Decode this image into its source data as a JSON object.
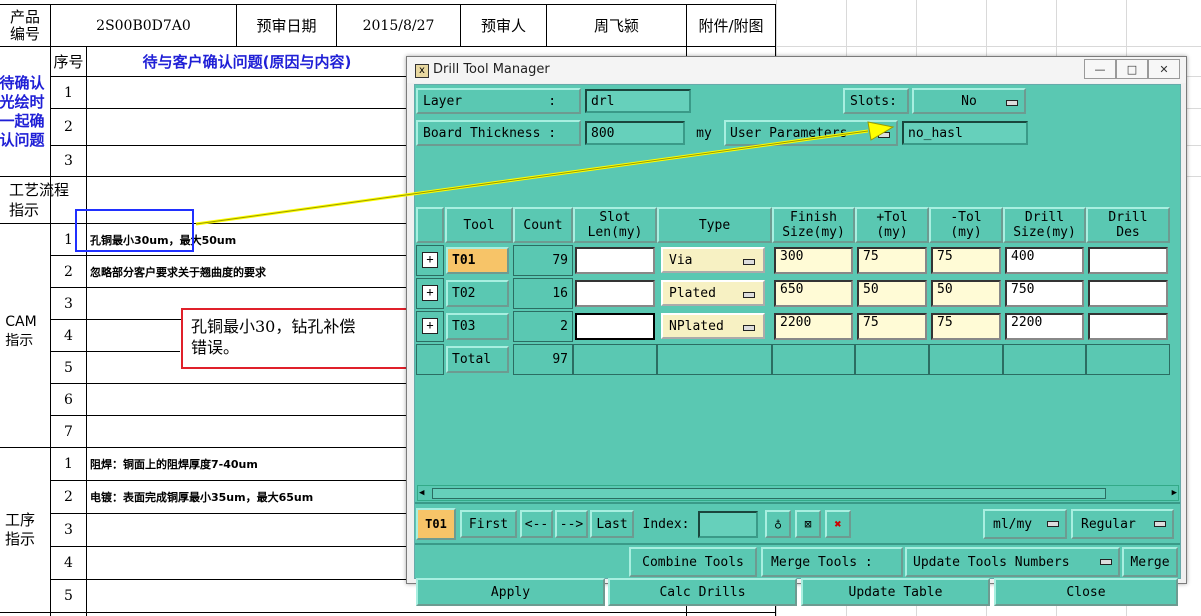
{
  "sheet": {
    "header": {
      "product_label": "产品\n编号",
      "product_code": "2S00B0D7A0",
      "review_date_label": "预审日期",
      "review_date": "2015/8/27",
      "reviewer_label": "预审人",
      "reviewer": "周飞颍",
      "attachment_label": "附件/附图"
    },
    "seq_label": "序号",
    "pending_label": "待与客户确认问题(原因与内容)",
    "pending_side": "待确认\n光绘时\n一起确\n认问题",
    "process_side": "工艺流程\n指示",
    "cam_side": "CAM\n指示",
    "procedure_side": "工序\n指示",
    "pending_rows": [
      "1",
      "2",
      "3"
    ],
    "cam_rows": [
      {
        "no": "1",
        "text": "孔铜最小30um，最大50um"
      },
      {
        "no": "2",
        "text": "忽略部分客户要求关于翘曲度的要求"
      },
      {
        "no": "3",
        "text": ""
      },
      {
        "no": "4",
        "text": ""
      },
      {
        "no": "5",
        "text": ""
      },
      {
        "no": "6",
        "text": ""
      },
      {
        "no": "7",
        "text": ""
      }
    ],
    "procedure_rows": [
      {
        "no": "1",
        "text": "阻焊：铜面上的阻焊厚度7-40um"
      },
      {
        "no": "2",
        "text": "电镀：表面完成铜厚最小35um，最大65um"
      },
      {
        "no": "3",
        "text": ""
      },
      {
        "no": "4",
        "text": ""
      },
      {
        "no": "5",
        "text": ""
      }
    ],
    "callout": "孔铜最小30，钻孔补偿\n错误。"
  },
  "dialog": {
    "title": "Drill Tool Manager",
    "layer_label": "Layer           :",
    "layer_value": "drl",
    "slots_label": "Slots:",
    "slots_value": "No",
    "board_thickness_label": "Board Thickness :",
    "board_thickness_value": "800",
    "board_thickness_unit": "my",
    "user_params_label": "User Parameters",
    "user_params_value": "no_hasl",
    "columns": [
      "Tool",
      "Count",
      "Slot\nLen(my)",
      "Type",
      "Finish\nSize(my)",
      "+Tol\n(my)",
      "-Tol\n(my)",
      "Drill\nSize(my)",
      "Drill\nDes"
    ],
    "rows": [
      {
        "tool": "T01",
        "count": "79",
        "slot": "",
        "type": "Via",
        "finish": "300",
        "ptol": "75",
        "ntol": "75",
        "drill": "400",
        "des": ""
      },
      {
        "tool": "T02",
        "count": "16",
        "slot": "",
        "type": "Plated",
        "finish": "650",
        "ptol": "50",
        "ntol": "50",
        "drill": "750",
        "des": ""
      },
      {
        "tool": "T03",
        "count": "2",
        "slot": "",
        "type": "NPlated",
        "finish": "2200",
        "ptol": "75",
        "ntol": "75",
        "drill": "2200",
        "des": ""
      }
    ],
    "total_label": "Total",
    "total_count": "97",
    "current_tool": "T01",
    "nav": {
      "first": "First",
      "prev": "<--",
      "next": "-->",
      "last": "Last",
      "index_label": "Index:"
    },
    "units_value": "ml/my",
    "mode_value": "Regular",
    "combine_label": "Combine Tools",
    "merge_tools_label": "Merge Tools :",
    "update_numbers_label": "Update Tools Numbers",
    "merge_label": "Merge",
    "apply_label": "Apply",
    "calc_label": "Calc Drills",
    "update_table_label": "Update Table",
    "close_label": "Close"
  },
  "colors": {
    "dialog_bg": "#5ac8b2",
    "input_yellow": "#fffbd6",
    "selected_tool": "#f7c468",
    "callout_border": "#e0202a",
    "highlight_box": "#2030ff",
    "arrow": "#ffff00"
  }
}
